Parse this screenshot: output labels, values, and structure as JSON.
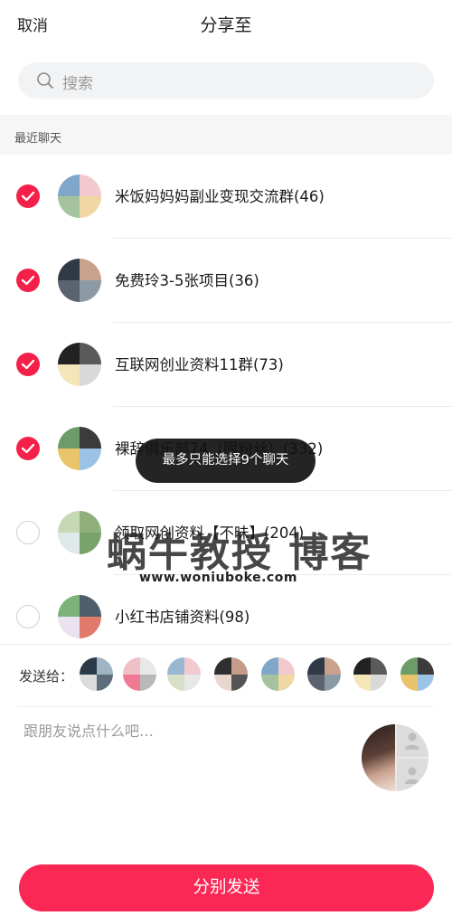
{
  "header": {
    "cancel_label": "取消",
    "title": "分享至"
  },
  "search": {
    "placeholder": "搜索"
  },
  "section": {
    "recent_label": "最近聊天"
  },
  "chats": [
    {
      "name": "米饭妈妈妈副业变现交流群(46)",
      "checked": true
    },
    {
      "name": "免费玲3-5张项目(36)",
      "checked": true
    },
    {
      "name": "互联网创业资料11群(73)",
      "checked": true
    },
    {
      "name": "裸辞俱乐部74（限粉丝）(332)",
      "checked": true
    },
    {
      "name": "领取网创资料【不昧】(204)",
      "checked": false
    },
    {
      "name": "小红书店铺资料(98)",
      "checked": false
    }
  ],
  "toast": {
    "text": "最多只能选择9个聊天"
  },
  "watermark": {
    "main": "蜗牛教授 博客",
    "url": "www.woniuboke.com"
  },
  "send_to": {
    "label": "发送给：",
    "count": 9
  },
  "message": {
    "placeholder": "跟朋友说点什么吧…"
  },
  "send_button": {
    "label": "分别发送"
  },
  "colors": {
    "accent": "#fb2855",
    "check": "#f5204a"
  }
}
